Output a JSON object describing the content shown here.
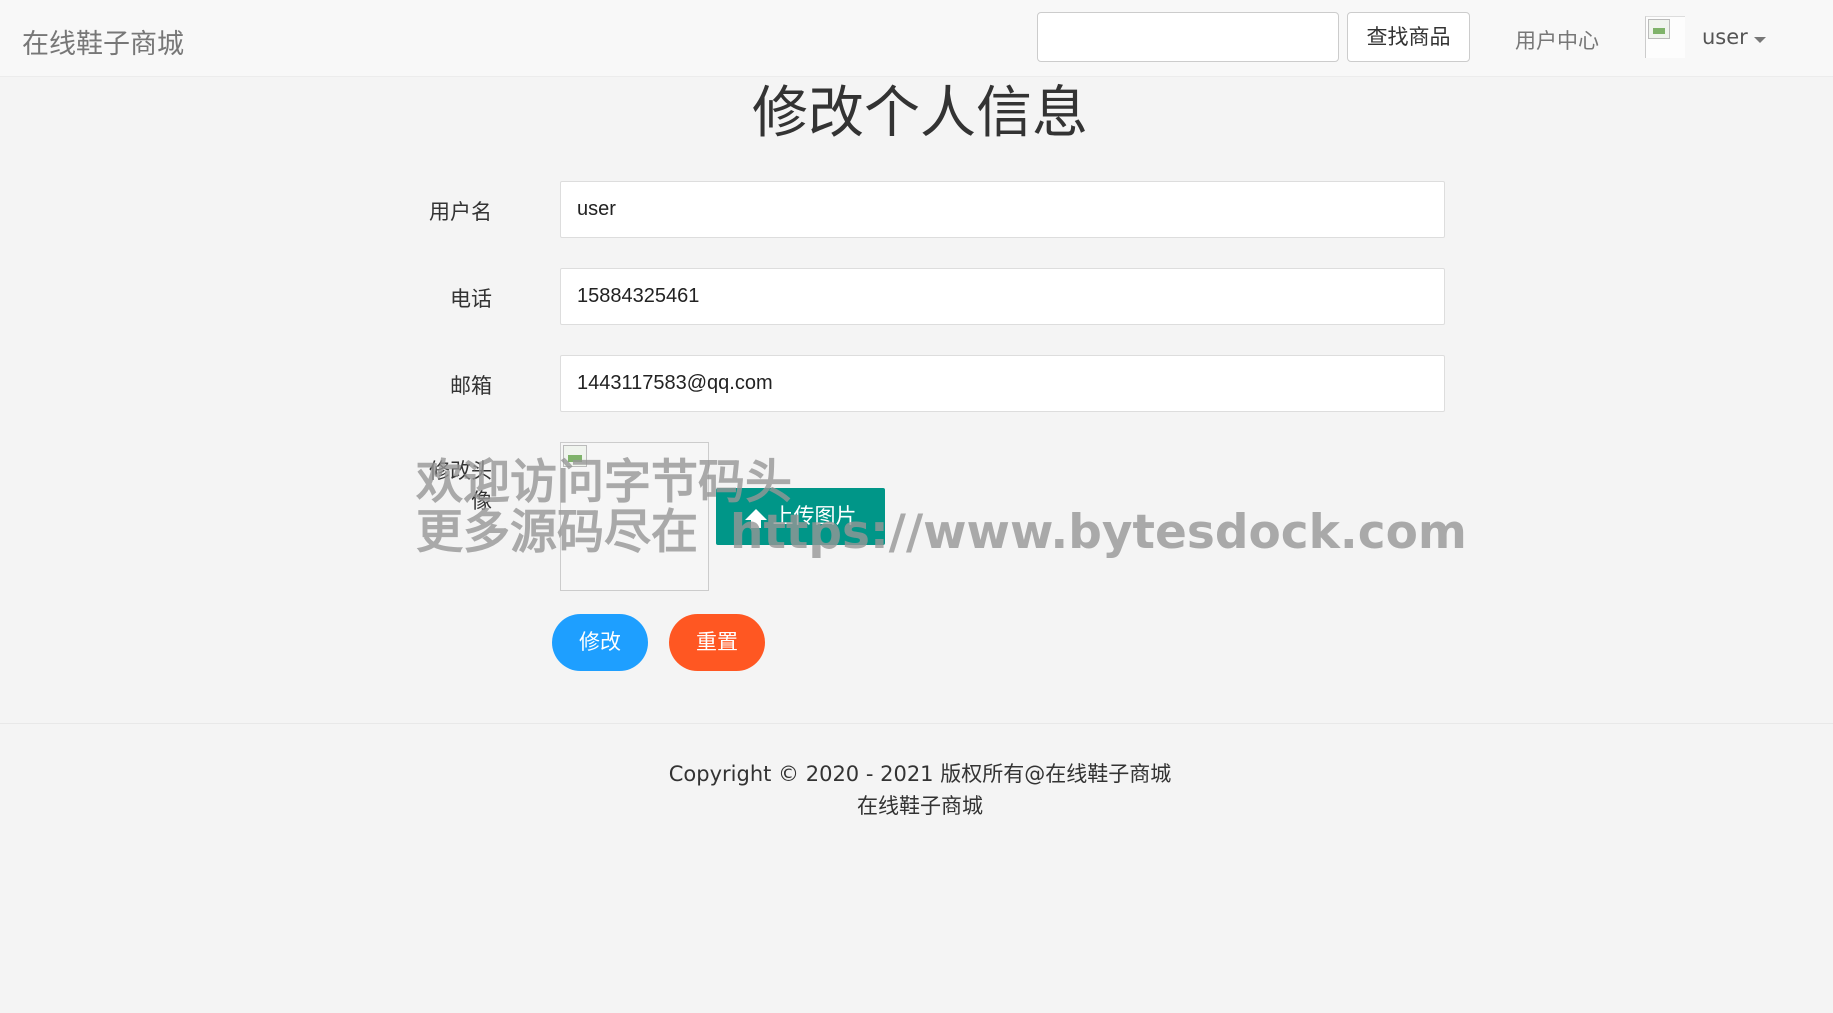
{
  "navbar": {
    "brand": "在线鞋子商城",
    "search": {
      "value": "",
      "placeholder": ""
    },
    "search_button": "查找商品",
    "user_center": "用户中心",
    "username": "user"
  },
  "page": {
    "title": "修改个人信息"
  },
  "form": {
    "username": {
      "label": "用户名",
      "value": "user"
    },
    "phone": {
      "label": "电话",
      "value": "15884325461"
    },
    "email": {
      "label": "邮箱",
      "value": "1443117583@qq.com"
    },
    "avatar": {
      "label": "修改头像",
      "upload_label": "上传图片"
    },
    "submit_label": "修改",
    "reset_label": "重置"
  },
  "watermark": {
    "line1": "欢迎访问字节码头",
    "line2": "更多源码尽在",
    "url": "https://www.bytesdock.com"
  },
  "footer": {
    "copyright": "Copyright © 2020 - 2021 版权所有@在线鞋子商城",
    "site_name": "在线鞋子商城"
  },
  "colors": {
    "submit": "#1e9fff",
    "reset": "#ff5722",
    "upload": "#009688"
  }
}
